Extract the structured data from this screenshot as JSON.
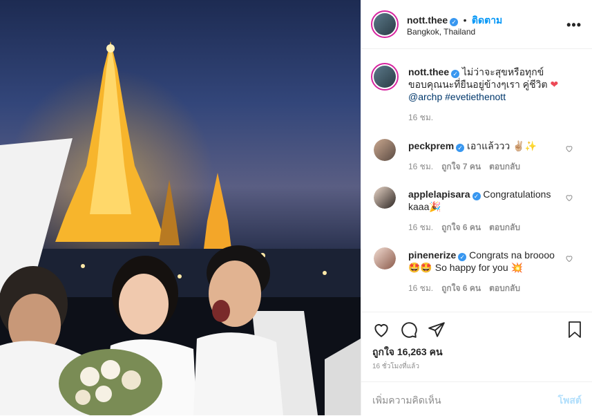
{
  "post": {
    "username": "nott.thee",
    "follow_label": "ติดตาม",
    "location": "Bangkok, Thailand",
    "more_label": "•••",
    "caption_part1": "ไม่ว่าจะสุขหรือทุกข์",
    "caption_part2": "ขอบคุณนะที่ยืนอยู่ข้างๆเรา คู่ชีวิต",
    "mention": "@archp",
    "hashtag": "#evetiethenott",
    "caption_time": "16 ชม.",
    "likes": "ถูกใจ 16,263 คน",
    "posted_ago": "16 ชั่วโมงที่แล้ว",
    "comment_placeholder": "เพิ่มความคิดเห็น",
    "post_button": "โพสต์"
  },
  "comments": [
    {
      "user": "peckprem",
      "text": "เอาแล้ววว ✌🏼✨",
      "time": "16 ชม.",
      "likes": "ถูกใจ 7 คน",
      "reply": "ตอบกลับ"
    },
    {
      "user": "applelapisara",
      "text": "Congratulations kaaa🎉",
      "time": "16 ชม.",
      "likes": "ถูกใจ 6 คน",
      "reply": "ตอบกลับ"
    },
    {
      "user": "pinenerize",
      "text": "Congrats na broooo 🤩🤩 So happy for you 💥",
      "time": "16 ชม.",
      "likes": "ถูกใจ 6 คน",
      "reply": "ตอบกลับ"
    }
  ],
  "colors": {
    "verified": "#3897f0",
    "follow": "#0095f6",
    "heart": "#ed4956"
  }
}
